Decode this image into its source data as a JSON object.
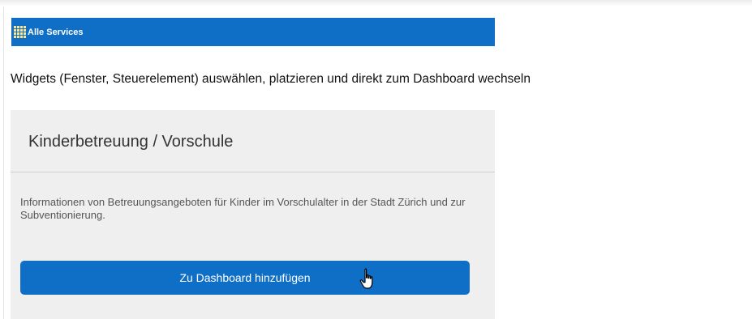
{
  "header": {
    "services_label": "Alle Services",
    "icon": "grid-icon",
    "icon_color": "#ffe58a"
  },
  "instruction": "Widgets (Fenster, Steuerelement) auswählen, platzieren und direkt zum Dashboard wechseln",
  "widget_card": {
    "title": "Kinderbetreuung / Vorschule",
    "description": "Informationen von Betreuungsangeboten für Kinder im Vorschulalter in der Stadt Zürich und zur Subventionierung.",
    "button_label": "Zu Dashboard hinzufügen"
  },
  "colors": {
    "accent": "#0f6fc6",
    "card_background": "#efefef"
  },
  "cursor": "hand-pointer-icon"
}
